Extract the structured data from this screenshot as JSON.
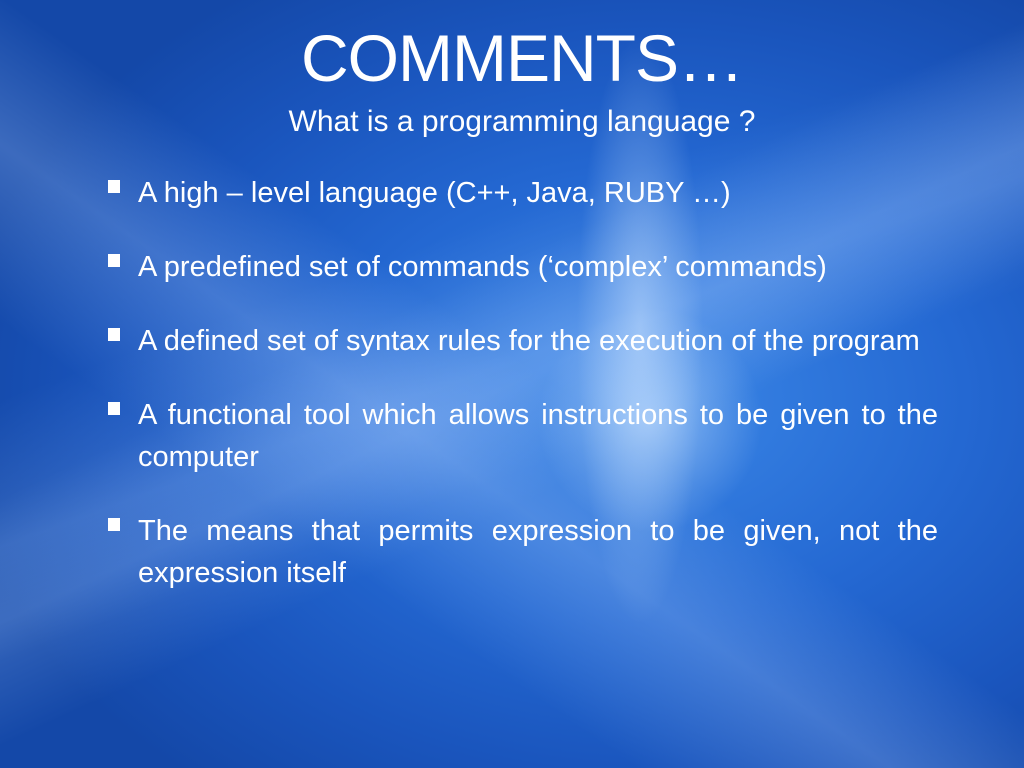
{
  "slide": {
    "title": "COMMENTS…",
    "subtitle": "What is a programming language ?",
    "bullets": [
      {
        "text": "A high – level language (C++, Java, RUBY …)"
      },
      {
        "text": "A predefined set of commands (‘complex’ commands)"
      },
      {
        "text": "A defined set of syntax rules for the execution of the program"
      },
      {
        "text": "A functional tool which allows instructions to be given to the computer"
      },
      {
        "text": "The means that permits expression to be given, not the expression itself"
      }
    ],
    "bullet_icon": "square-bullet-icon",
    "colors": {
      "background": "#1f63c9",
      "text": "#ffffff"
    }
  }
}
